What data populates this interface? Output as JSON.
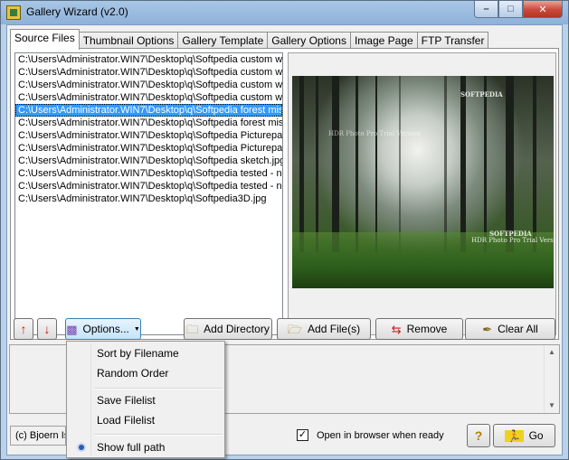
{
  "window": {
    "title": "Gallery Wizard (v2.0)",
    "controls": {
      "minimize": "–",
      "maximize": "□",
      "close": "✕"
    }
  },
  "tabs": [
    {
      "label": "Source Files",
      "active": true
    },
    {
      "label": "Thumbnail Options",
      "active": false
    },
    {
      "label": "Gallery Template",
      "active": false
    },
    {
      "label": "Gallery Options",
      "active": false
    },
    {
      "label": "Image Page",
      "active": false
    },
    {
      "label": "FTP Transfer",
      "active": false
    }
  ],
  "files": [
    "C:\\Users\\Administrator.WIN7\\Desktop\\q\\Softpedia custom wa",
    "C:\\Users\\Administrator.WIN7\\Desktop\\q\\Softpedia custom wa",
    "C:\\Users\\Administrator.WIN7\\Desktop\\q\\Softpedia custom wa",
    "C:\\Users\\Administrator.WIN7\\Desktop\\q\\Softpedia custom wa",
    "C:\\Users\\Administrator.WIN7\\Desktop\\q\\Softpedia forest mis",
    "C:\\Users\\Administrator.WIN7\\Desktop\\q\\Softpedia forest mis",
    "C:\\Users\\Administrator.WIN7\\Desktop\\q\\Softpedia Picturepar",
    "C:\\Users\\Administrator.WIN7\\Desktop\\q\\Softpedia Picturepar",
    "C:\\Users\\Administrator.WIN7\\Desktop\\q\\Softpedia sketch.jpg",
    "C:\\Users\\Administrator.WIN7\\Desktop\\q\\Softpedia tested - ne",
    "C:\\Users\\Administrator.WIN7\\Desktop\\q\\Softpedia tested - ne",
    "C:\\Users\\Administrator.WIN7\\Desktop\\q\\Softpedia3D.jpg"
  ],
  "selected_file_index": 4,
  "preview": {
    "watermarks": [
      "SOFTPEDIA",
      "HDR Photo Pro Trial Version",
      "SOFTPEDIA",
      "HDR Photo Pro Trial Version"
    ]
  },
  "toolbar": {
    "move_up_icon": "arrow-up-icon",
    "move_down_icon": "arrow-down-icon",
    "options_label": "Options...",
    "add_directory_label": "Add Directory",
    "add_files_label": "Add File(s)",
    "remove_label": "Remove",
    "clear_all_label": "Clear All"
  },
  "options_menu": {
    "items": [
      {
        "label": "Sort by Filename"
      },
      {
        "label": "Random Order"
      },
      {
        "label": "Save Filelist"
      },
      {
        "label": "Load Filelist"
      },
      {
        "label": "Show full path",
        "checked": true
      }
    ]
  },
  "footer": {
    "copyright": "(c) Bjoern Is",
    "open_browser_label": "Open in browser when ready",
    "open_browser_checked": true,
    "help_label": "?",
    "go_label": "Go"
  },
  "colors": {
    "selection": "#3399ff",
    "title_bar": "#a9c6e6",
    "close_button": "#c8493a",
    "arrow_red": "#d21414"
  }
}
